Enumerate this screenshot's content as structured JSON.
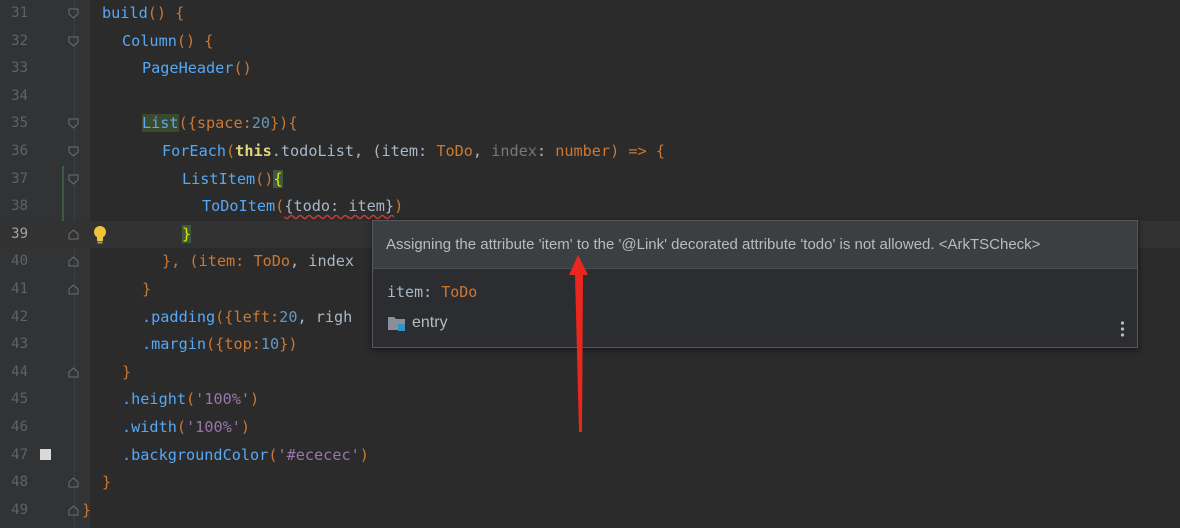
{
  "editor": {
    "lines": [
      {
        "num": "31"
      },
      {
        "num": "32"
      },
      {
        "num": "33"
      },
      {
        "num": "34"
      },
      {
        "num": "35"
      },
      {
        "num": "36"
      },
      {
        "num": "37"
      },
      {
        "num": "38"
      },
      {
        "num": "39"
      },
      {
        "num": "40"
      },
      {
        "num": "41"
      },
      {
        "num": "42"
      },
      {
        "num": "43"
      },
      {
        "num": "44"
      },
      {
        "num": "45"
      },
      {
        "num": "46"
      },
      {
        "num": "47"
      },
      {
        "num": "48"
      },
      {
        "num": "49"
      }
    ],
    "tokens": {
      "build": "build",
      "paren_brace": "() {",
      "column": "Column",
      "page_header": "PageHeader",
      "empty_parens": "()",
      "list": "List",
      "list_args_open": "({space:",
      "list_space": "20",
      "list_args_close": "}){",
      "foreach": "ForEach",
      "open_paren": "(",
      "this": "this",
      "todolist": ".todoList, (item: ",
      "todo_type": "ToDo",
      "comma_space": ", ",
      "index_hint": "index",
      "colon_space": ": ",
      "number_type": "number",
      "arrow_open": ") => {",
      "list_item": "ListItem",
      "brace_open": "{",
      "todo_item": "ToDoItem",
      "todo_args_open": "({todo: ",
      "item_word": "item",
      "todo_args_close": "})",
      "brace_close": "}",
      "close_paren_comma": "}, (item: ",
      "index_trunc": ", index",
      "padding": ".padding",
      "padding_args": "({left:",
      "padding_left": "20",
      "padding_trunc": ", righ",
      "margin": ".margin",
      "margin_args": "({top:",
      "margin_top": "10",
      "margin_close": "})",
      "height": ".height",
      "height_val": "'100%'",
      "width": ".width",
      "width_val": "'100%'",
      "bg": ".backgroundColor",
      "bg_val": "'#ececec'",
      "lparen": "(",
      "rparen": ")"
    }
  },
  "popup": {
    "message": "Assigning the attribute 'item' to the '@Link' decorated attribute 'todo' is not allowed. <ArkTSCheck>",
    "type_name": "item",
    "type_colon": ": ",
    "type_value": "ToDo",
    "module": "entry"
  },
  "icons": {
    "bulb": "lightbulb-icon",
    "folder": "folder-icon",
    "more": "more-vertical-icon"
  },
  "colors": {
    "annotation_arrow": "#e8281f",
    "keyword": "#cc7832",
    "function": "#56a8f5"
  }
}
